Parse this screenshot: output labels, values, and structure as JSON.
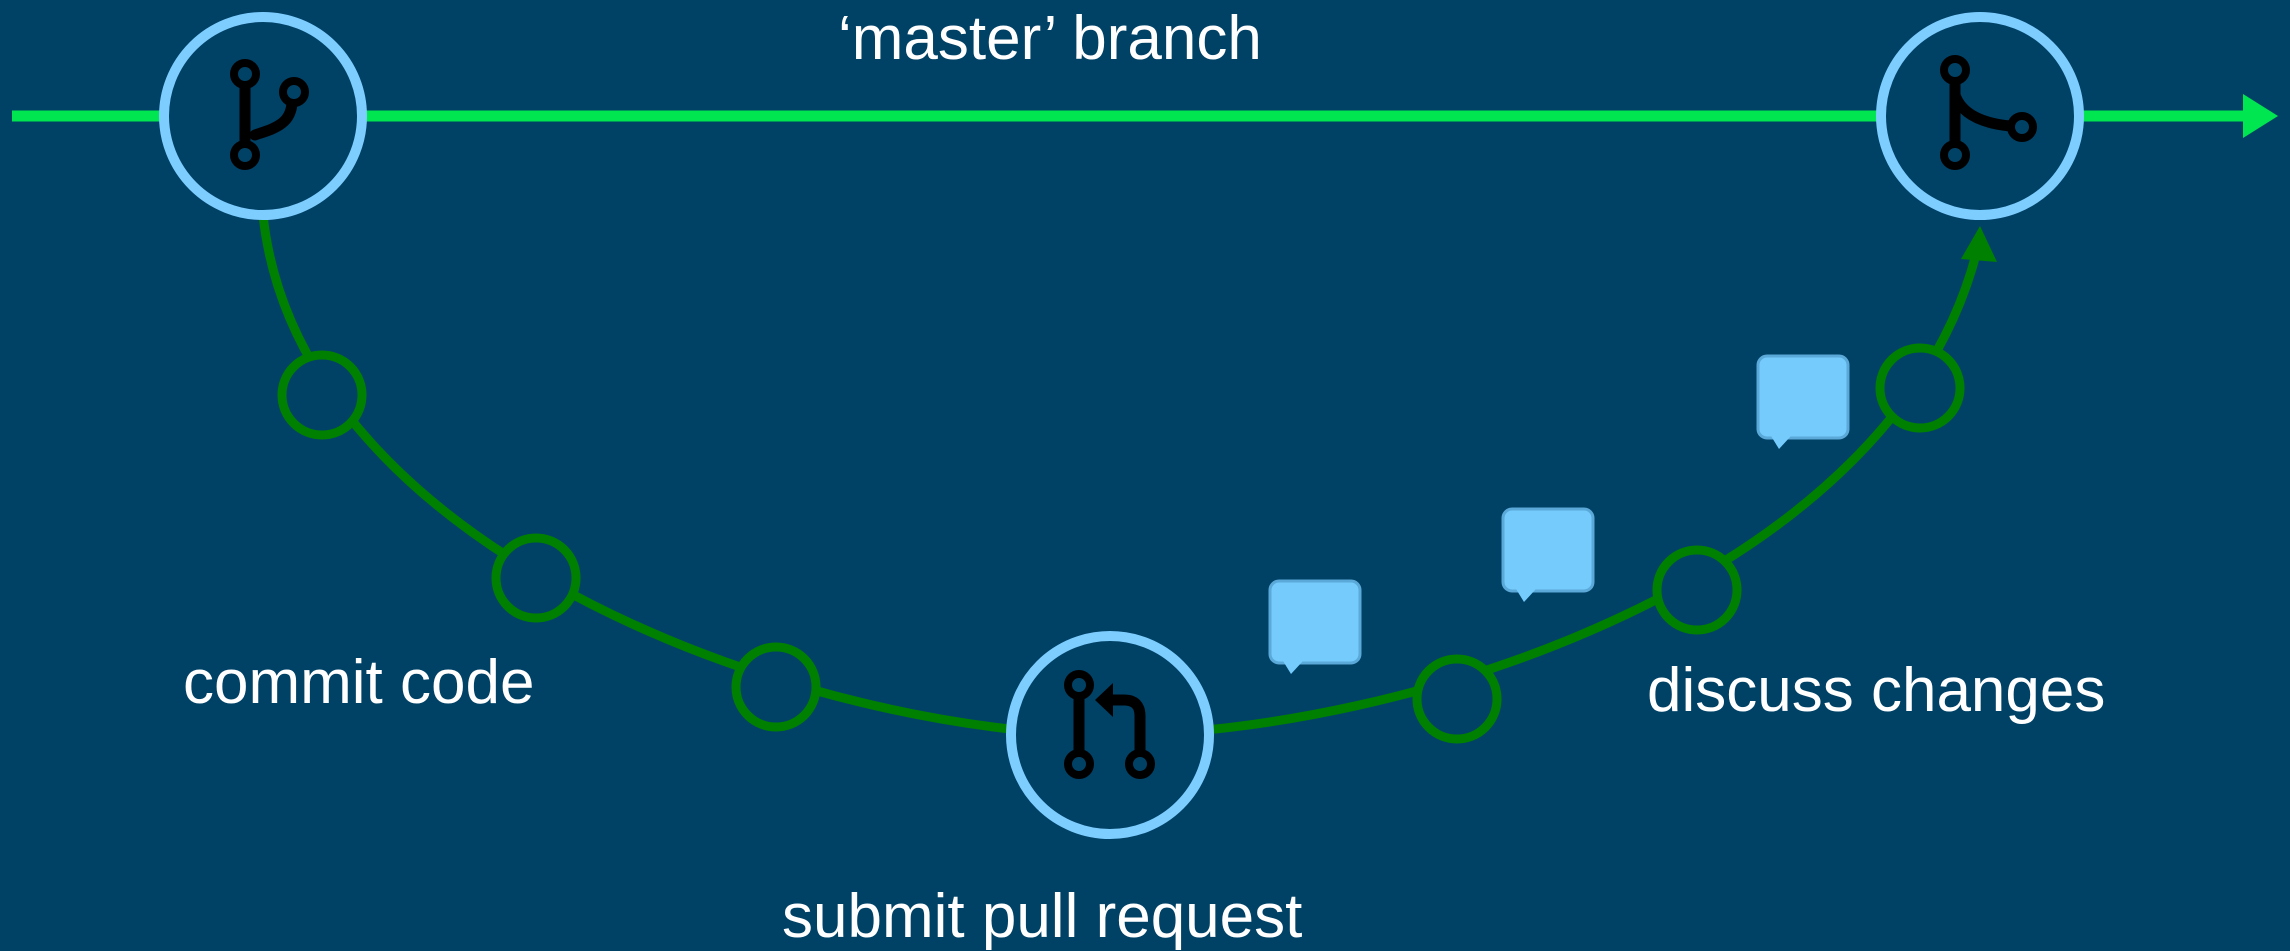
{
  "labels": {
    "master": "‘master’ branch",
    "commit": "commit code",
    "submit": "submit pull request",
    "discuss": "discuss changes"
  },
  "colors": {
    "background": "#004166",
    "main_line": "#00e650",
    "branch_line": "#008000",
    "node_ring": "#7dcdff",
    "comment_fill": "#74cbfc",
    "icon": "#000000",
    "text": "#ffffff"
  },
  "icons": {
    "start_node": "branch-icon",
    "middle_node": "pull-request-icon",
    "end_node": "merge-icon",
    "comments": "comment-bubble-icon"
  }
}
